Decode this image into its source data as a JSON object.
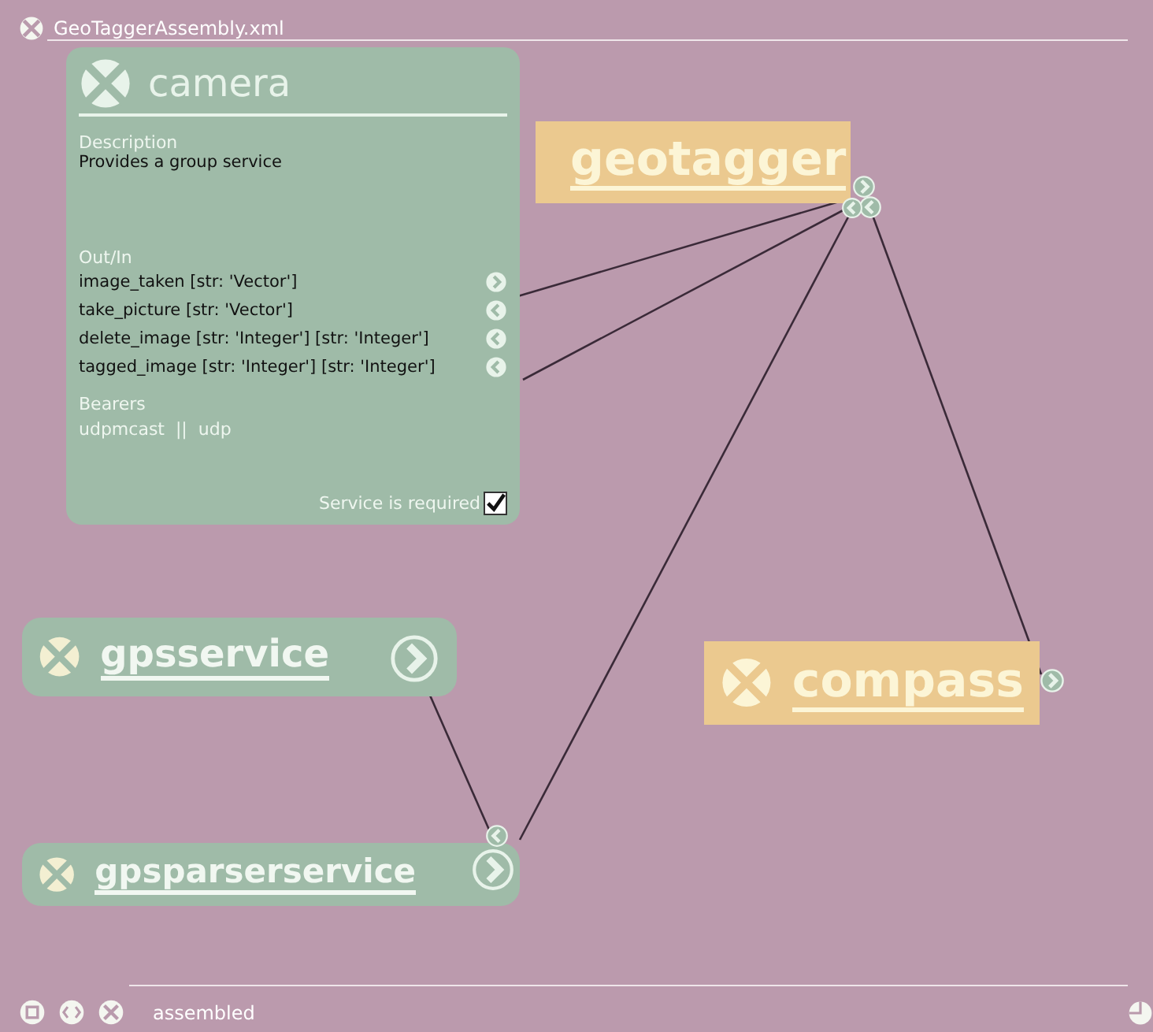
{
  "window": {
    "title": "GeoTaggerAssembly.xml"
  },
  "nodes": [
    {
      "name": "camera",
      "kind": "expanded",
      "color": "#9fbba8",
      "description_label": "Description",
      "description": "Provides a group service",
      "ports_label": "Out/In",
      "ports": [
        {
          "label": "image_taken [str: 'Vector']",
          "kind": "output"
        },
        {
          "label": "take_picture [str: 'Vector']",
          "kind": "input"
        },
        {
          "label": "delete_image [str: 'Integer'] [str: 'Integer']",
          "kind": "input"
        },
        {
          "label": "tagged_image [str: 'Integer'] [str: 'Integer']",
          "kind": "input"
        }
      ],
      "bearers_label": "Bearers",
      "bearers": "udpmcast  ||  udp",
      "required": {
        "label": "Service is required",
        "checked": true
      }
    },
    {
      "name": "geotagger",
      "kind": "collapsed",
      "color": "#ebc98f",
      "ports": [
        {
          "kind": "output"
        },
        {
          "kind": "input"
        },
        {
          "kind": "input"
        }
      ]
    },
    {
      "name": "gpsservice",
      "kind": "collapsed",
      "color": "#9fbba8",
      "ports": [
        {
          "kind": "output"
        }
      ]
    },
    {
      "name": "gpsparserservice",
      "kind": "collapsed",
      "color": "#9fbba8",
      "ports": [
        {
          "kind": "output"
        },
        {
          "kind": "input"
        }
      ]
    },
    {
      "name": "compass",
      "kind": "collapsed",
      "color": "#ebc98f",
      "ports": [
        {
          "kind": "output"
        }
      ]
    }
  ],
  "status_bar": {
    "text": "assembled"
  }
}
